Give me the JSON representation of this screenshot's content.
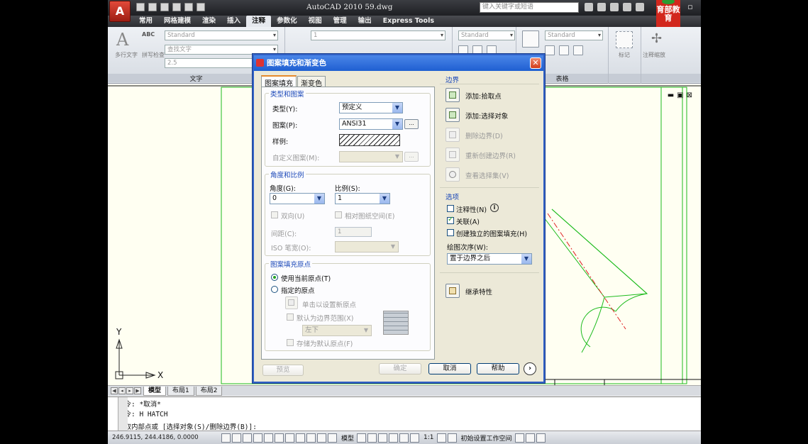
{
  "app": {
    "logo_letter": "A",
    "title": "AutoCAD 2010   59.dwg",
    "search_placeholder": "键入关键字或短语",
    "edu_logo": "育部教育"
  },
  "ribbon": {
    "tabs": [
      "常用",
      "网格建模",
      "渲染",
      "插入",
      "注释",
      "参数化",
      "视图",
      "管理",
      "输出",
      "Express Tools"
    ],
    "active_tab": "注释",
    "text_group": {
      "multiline_label": "多行文字",
      "spell_label": "拼写检查",
      "abc_label": "ABC",
      "style_value": "Standard",
      "find_placeholder": "查找文字",
      "height_value": "2.5",
      "group_label": "文字"
    },
    "dim_value": "1",
    "style2_value": "Standard",
    "table_style_value": "Standard",
    "table_group_label": "表格",
    "mark_label": "标记",
    "annot_scale_label": "注释缩放"
  },
  "dialog": {
    "title": "图案填充和渐变色",
    "tabs": [
      "图案填充",
      "渐变色"
    ],
    "type_pattern": {
      "group": "类型和图案",
      "type_label": "类型(Y):",
      "type_value": "预定义",
      "pattern_label": "图案(P):",
      "pattern_value": "ANSI31",
      "swatch_label": "样例:",
      "custom_label": "自定义图案(M):",
      "browse_label": "..."
    },
    "angle_scale": {
      "group": "角度和比例",
      "angle_label": "角度(G):",
      "angle_value": "0",
      "scale_label": "比例(S):",
      "scale_value": "1",
      "double_label": "双向(U)",
      "relative_label": "相对图纸空间(E)",
      "spacing_label": "间距(C):",
      "spacing_value": "1",
      "iso_label": "ISO 笔宽(O):"
    },
    "origin": {
      "group": "图案填充原点",
      "use_current": "使用当前原点(T)",
      "specified": "指定的原点",
      "click_set": "单击以设置新原点",
      "default_extent": "默认为边界范围(X)",
      "extent_value": "左下",
      "store_default": "存储为默认原点(F)"
    },
    "boundary": {
      "group": "边界",
      "add_pick": "添加:拾取点",
      "add_select": "添加:选择对象",
      "remove": "删除边界(D)",
      "recreate": "重新创建边界(R)",
      "view_sel": "查看选择集(V)"
    },
    "options": {
      "group": "选项",
      "annotative": "注释性(N)",
      "associative": "关联(A)",
      "separate": "创建独立的图案填充(H)",
      "draw_order_label": "绘图次序(W):",
      "draw_order_value": "置于边界之后"
    },
    "inherit": "继承特性",
    "buttons": {
      "preview": "预览",
      "ok": "确定",
      "cancel": "取消",
      "help": "帮助"
    }
  },
  "layout_tabs": [
    "模型",
    "布局1",
    "布局2"
  ],
  "command": {
    "line1": "命令: *取消*",
    "line2": "命令: H HATCH",
    "line3": "拾取内部点或 [选择对象(S)/删除边界(B)]:"
  },
  "status": {
    "coords": "246.9115, 244.4186, 0.0000",
    "model": "模型",
    "scale": "1:1",
    "workspace": "初始设置工作空间"
  },
  "ucs": {
    "x_label": "X",
    "y_label": "Y"
  }
}
